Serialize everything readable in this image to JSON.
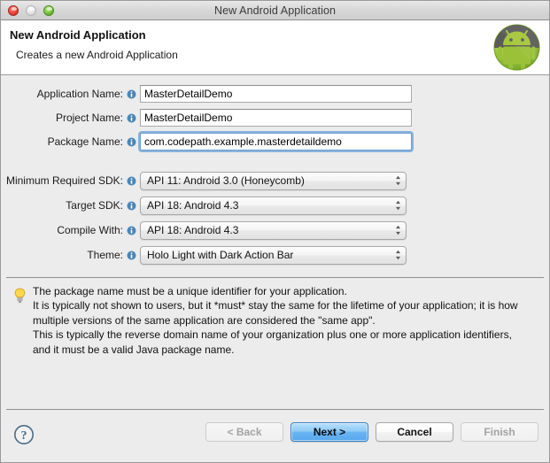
{
  "window": {
    "title": "New Android Application",
    "traffic_lights": [
      "close-button",
      "minimize-button",
      "zoom-button"
    ]
  },
  "header": {
    "title": "New Android Application",
    "subtitle": "Creates a new Android Application",
    "logo": "android-robot-logo"
  },
  "form": {
    "text_fields": [
      {
        "label": "Application Name:",
        "value": "MasterDetailDemo",
        "placeholder": "",
        "focused": false,
        "info_icon": "info-icon"
      },
      {
        "label": "Project Name:",
        "value": "MasterDetailDemo",
        "placeholder": "",
        "focused": false,
        "info_icon": "info-icon"
      },
      {
        "label": "Package Name:",
        "value": "com.codepath.example.masterdetaildemo",
        "placeholder": "",
        "focused": true,
        "info_icon": "info-icon"
      }
    ],
    "dropdowns": [
      {
        "label": "Minimum Required SDK:",
        "value": "API 11: Android 3.0 (Honeycomb)",
        "info_icon": "info-icon"
      },
      {
        "label": "Target SDK:",
        "value": "API 18: Android 4.3",
        "info_icon": "info-icon"
      },
      {
        "label": "Compile With:",
        "value": "API 18: Android 4.3",
        "info_icon": "info-icon"
      },
      {
        "label": "Theme:",
        "value": "Holo Light with Dark Action Bar",
        "info_icon": "info-icon"
      }
    ]
  },
  "tip": {
    "icon": "lightbulb-icon",
    "lines": [
      "The package name must be a unique identifier for your application.",
      "It is typically not shown to users, but it *must* stay the same for the lifetime of your application; it is how",
      "multiple versions of the same application are considered the \"same app\".",
      "This is typically the reverse domain name of your organization plus one or more application identifiers,",
      "and it must be a valid Java package name."
    ]
  },
  "buttons": {
    "help": "help-icon",
    "back": {
      "label": "< Back",
      "disabled": true
    },
    "next": {
      "label": "Next >",
      "disabled": false,
      "is_default": true
    },
    "cancel": {
      "label": "Cancel",
      "disabled": false
    },
    "finish": {
      "label": "Finish",
      "disabled": true
    }
  },
  "colors": {
    "window_bg": "#ececec",
    "header_bg": "#ffffff",
    "accent_blue": "#57a8ee",
    "focus_ring": "#6aa0db",
    "info_icon_blue": "#3a7fbe",
    "bulb_yellow": "#ffd24a",
    "android_green": "#8bc34a"
  }
}
